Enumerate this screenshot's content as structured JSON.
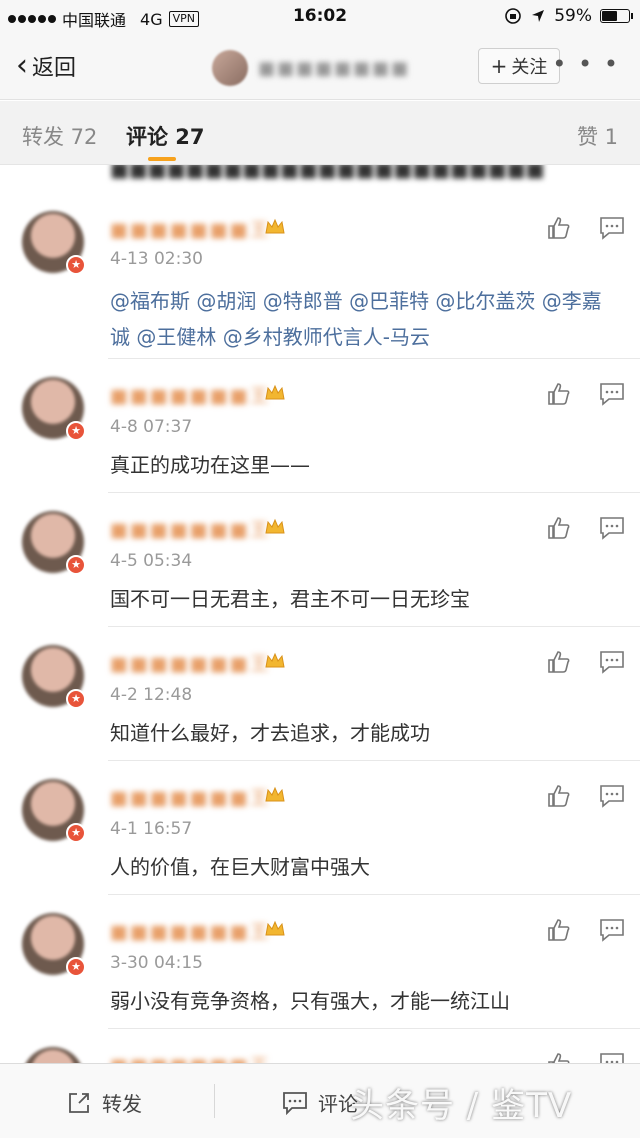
{
  "status_bar": {
    "carrier": "中国联通",
    "network": "4G",
    "vpn": "VPN",
    "time": "16:02",
    "battery": "59%",
    "battery_level": 0.59
  },
  "nav": {
    "back_label": "返回",
    "follow_label": "关注",
    "more_label": "• • •"
  },
  "tabs": {
    "repost": "转发 72",
    "comment": "评论 27",
    "like": "赞 1"
  },
  "comments": [
    {
      "time": "4-13 02:30",
      "text": "@福布斯 @胡润 @特郎普 @巴菲特 @比尔盖茨 @李嘉诚 @王健林 @乡村教师代言人-马云",
      "is_link": true
    },
    {
      "time": "4-8 07:37",
      "text": "真正的成功在这里——"
    },
    {
      "time": "4-5 05:34",
      "text": "国不可一日无君主，君主不可一日无珍宝"
    },
    {
      "time": "4-2 12:48",
      "text": "知道什么最好，才去追求，才能成功"
    },
    {
      "time": "4-1 16:57",
      "text": "人的价值，在巨大财富中强大"
    },
    {
      "time": "3-30 04:15",
      "text": "弱小没有竞争资格，只有强大，才能一统江山"
    }
  ],
  "toolbar": {
    "repost_label": "转发",
    "comment_label": "评论",
    "watermark": "头条号 / 鉴TV"
  }
}
